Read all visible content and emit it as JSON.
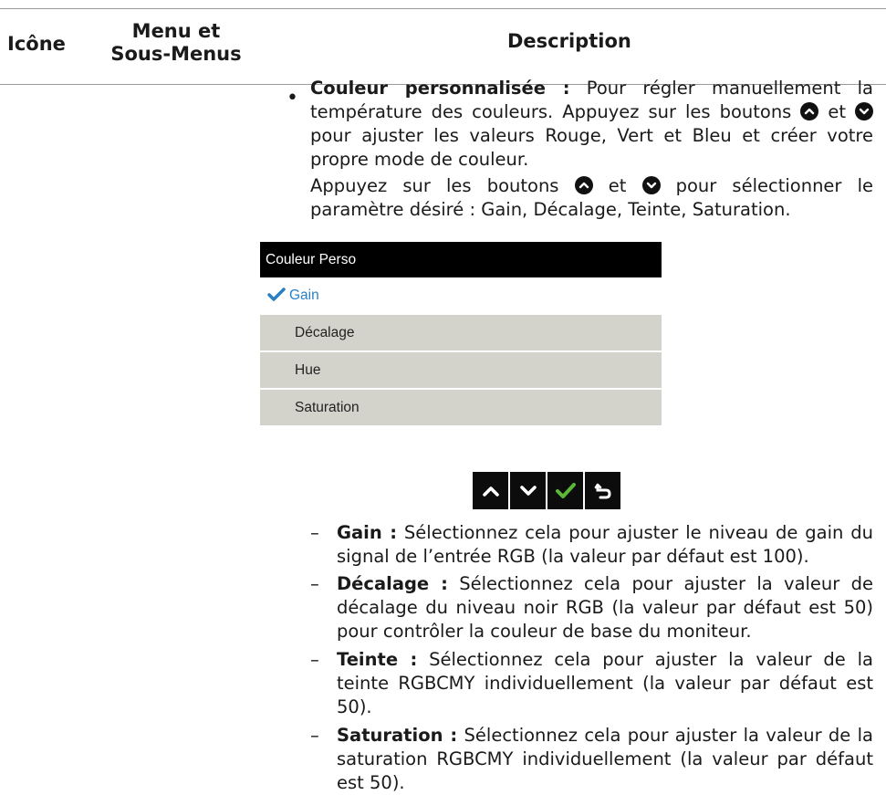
{
  "table_header": {
    "icon": "Icône",
    "menu_line1": "Menu et",
    "menu_line2": "Sous-Menus",
    "description": "Description"
  },
  "custom_color": {
    "bullet": "•",
    "label": "Couleur personnalisée :",
    "text_a": "Pour régler manuellement la température des couleurs. Appuyez sur les boutons",
    "text_b": "et",
    "text_c": "pour ajuster les valeurs Rouge, Vert et Bleu et créer votre propre mode de couleur.",
    "para2_a": "Appuyez sur les boutons",
    "para2_b": "et",
    "para2_c": "pour sélectionner le paramètre désiré : Gain, Décalage, Teinte, Saturation."
  },
  "osd": {
    "title": "Couleur Perso",
    "items": [
      "Gain",
      "Décalage",
      "Hue",
      "Saturation"
    ],
    "selected_color": "#2a7fc4",
    "check_color": "#5cb63a"
  },
  "nav_buttons": [
    "up-icon",
    "down-icon",
    "check-icon",
    "back-icon"
  ],
  "subitems": [
    {
      "dash": "–",
      "label": "Gain :",
      "text": "Sélectionnez cela pour ajuster le niveau de gain du signal de l’entrée RGB (la valeur par défaut est 100)."
    },
    {
      "dash": "–",
      "label": "Décalage :",
      "text": "Sélectionnez cela pour ajuster la valeur de décalage du niveau noir RGB (la valeur par défaut est 50) pour contrôler la couleur de base du moniteur."
    },
    {
      "dash": "–",
      "label": "Teinte :",
      "text": "Sélectionnez cela pour ajuster la valeur de la teinte RGBCMY individuellement (la valeur par défaut est 50)."
    },
    {
      "dash": "–",
      "label": "Saturation :",
      "text": "Sélectionnez cela pour ajuster la valeur de la saturation RGBCMY individuellement (la valeur par défaut est 50)."
    }
  ]
}
